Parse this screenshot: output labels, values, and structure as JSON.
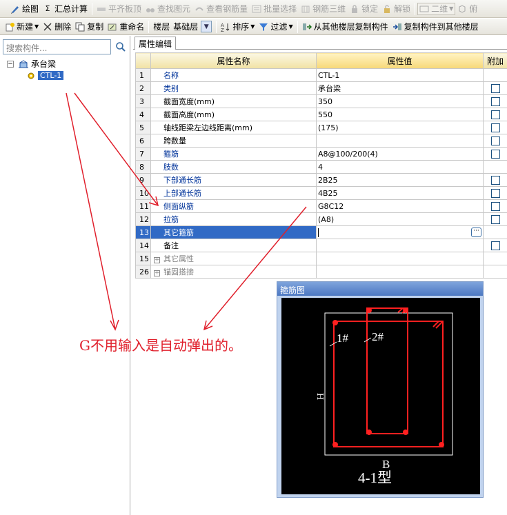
{
  "toolbar_main": {
    "items": [
      {
        "label": "绘图",
        "icon": "draw-icon",
        "enabled": true
      },
      {
        "label": "汇总计算",
        "icon": "sigma-icon",
        "enabled": true
      },
      {
        "label": "平齐板顶",
        "icon": "flush-slab-icon",
        "enabled": false
      },
      {
        "label": "查找图元",
        "icon": "binoculars-icon",
        "enabled": false
      },
      {
        "label": "查看钢筋量",
        "icon": "view-rebar-icon",
        "enabled": false
      },
      {
        "label": "批量选择",
        "icon": "batch-select-icon",
        "enabled": false
      },
      {
        "label": "钢筋三维",
        "icon": "rebar-3d-icon",
        "enabled": false
      },
      {
        "label": "锁定",
        "icon": "lock-icon",
        "enabled": false
      },
      {
        "label": "解锁",
        "icon": "unlock-icon",
        "enabled": false
      }
    ],
    "view_mode": "二维",
    "overflow_label": "俯"
  },
  "toolbar_component": {
    "new_label": "新建",
    "delete_label": "删除",
    "copy_label": "复制",
    "rename_label": "重命名",
    "floor_label": "楼层",
    "floor_value": "基础层",
    "sort_label": "排序",
    "filter_label": "过滤",
    "copy_from_floor_label": "从其他楼层复制构件",
    "copy_to_floor_label": "复制构件到其他楼层"
  },
  "sidebar": {
    "search_placeholder": "搜索构件...",
    "tree": {
      "root_label": "承台梁",
      "root_expander": "−",
      "child_label": "CTL-1"
    }
  },
  "property_panel": {
    "tab_label": "属性编辑",
    "columns": {
      "name": "属性名称",
      "value": "属性值",
      "extra": "附加"
    },
    "rows": [
      {
        "num": "1",
        "name": "名称",
        "value": "CTL-1",
        "style": "blue",
        "checkbox": false
      },
      {
        "num": "2",
        "name": "类别",
        "value": "承台梁",
        "style": "blue",
        "checkbox": true
      },
      {
        "num": "3",
        "name": "截面宽度(mm)",
        "value": "350",
        "style": "black",
        "checkbox": true
      },
      {
        "num": "4",
        "name": "截面高度(mm)",
        "value": "550",
        "style": "black",
        "checkbox": true
      },
      {
        "num": "5",
        "name": "轴线距梁左边线距离(mm)",
        "value": "(175)",
        "style": "black",
        "checkbox": true
      },
      {
        "num": "6",
        "name": "跨数量",
        "value": "",
        "style": "black",
        "checkbox": true
      },
      {
        "num": "7",
        "name": "箍筋",
        "value": "A8@100/200(4)",
        "style": "blue",
        "checkbox": true
      },
      {
        "num": "8",
        "name": "肢数",
        "value": "4",
        "style": "blue",
        "checkbox": false
      },
      {
        "num": "9",
        "name": "下部通长筋",
        "value": "2B25",
        "style": "blue",
        "checkbox": true
      },
      {
        "num": "10",
        "name": "上部通长筋",
        "value": "4B25",
        "style": "blue",
        "checkbox": true
      },
      {
        "num": "11",
        "name": "侧面纵筋",
        "value": "G8C12",
        "style": "blue",
        "checkbox": true
      },
      {
        "num": "12",
        "name": "拉筋",
        "value": "(A8)",
        "style": "blue",
        "checkbox": true
      },
      {
        "num": "13",
        "name": "其它箍筋",
        "value": "",
        "style": "selected",
        "checkbox": false
      },
      {
        "num": "14",
        "name": "备注",
        "value": "",
        "style": "black",
        "checkbox": true
      },
      {
        "num": "15",
        "name": "其它属性",
        "value": "",
        "style": "gray",
        "checkbox": false
      },
      {
        "num": "26",
        "name": "锚固搭接",
        "value": "",
        "style": "gray",
        "checkbox": false
      }
    ],
    "editing_row_index": 12,
    "ellipsis_label": "···"
  },
  "stirrup_diagram": {
    "title": "箍筋图",
    "label_1": "1#",
    "label_2": "2#",
    "h_label": "H",
    "b_label": "B",
    "type_label": "4-1型",
    "rebar_color": "#ff2020"
  },
  "annotation": {
    "text": "G不用输入是自动弹出的。",
    "color": "#e0202c"
  }
}
